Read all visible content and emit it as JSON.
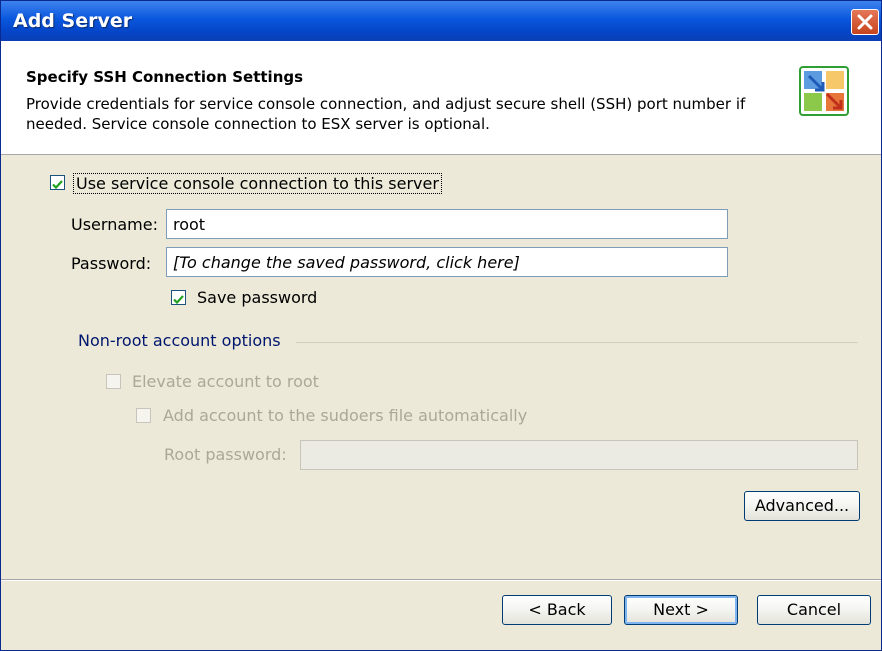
{
  "window": {
    "title": "Add Server"
  },
  "header": {
    "title": "Specify SSH Connection Settings",
    "description": "Provide credentials for service console connection, and adjust secure shell (SSH) port number if needed. Service console connection to ESX server is optional."
  },
  "ssh": {
    "use_console_label": "Use service console connection to this server",
    "use_console_checked": true,
    "username_label": "Username:",
    "username_value": "root",
    "password_label": "Password:",
    "password_value": "[To change the saved password, click here]",
    "save_password_label": "Save password",
    "save_password_checked": true
  },
  "nonroot": {
    "group_title": "Non-root account options",
    "elevate_label": "Elevate account to root",
    "elevate_checked": false,
    "sudoers_label": "Add account to the sudoers file automatically",
    "sudoers_checked": false,
    "root_password_label": "Root password:",
    "root_password_value": ""
  },
  "buttons": {
    "advanced": "Advanced...",
    "back": "< Back",
    "next": "Next >",
    "cancel": "Cancel"
  },
  "colors": {
    "titlebar": "#0a57de",
    "dialog_bg": "#ece9d8",
    "checkmark": "#21a121"
  }
}
